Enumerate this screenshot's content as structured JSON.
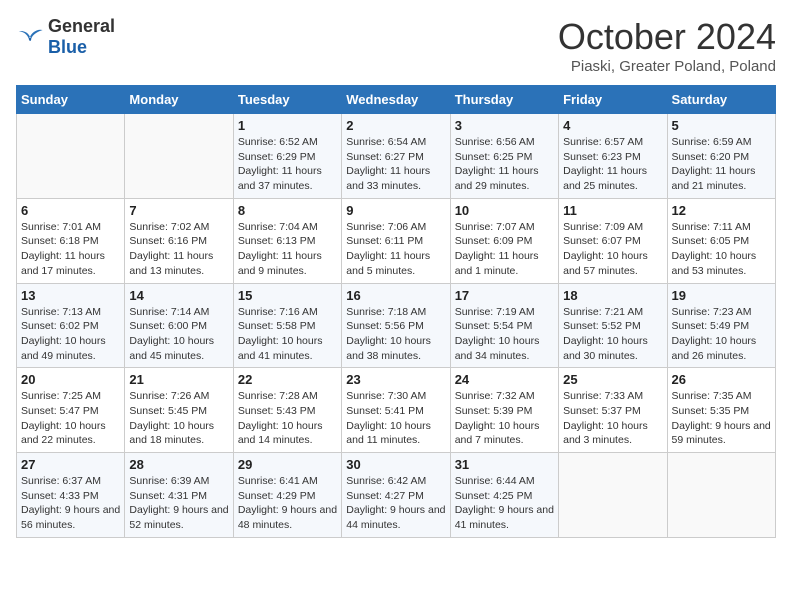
{
  "header": {
    "logo_general": "General",
    "logo_blue": "Blue",
    "month_title": "October 2024",
    "location": "Piaski, Greater Poland, Poland"
  },
  "weekdays": [
    "Sunday",
    "Monday",
    "Tuesday",
    "Wednesday",
    "Thursday",
    "Friday",
    "Saturday"
  ],
  "weeks": [
    [
      {
        "day": "",
        "detail": ""
      },
      {
        "day": "",
        "detail": ""
      },
      {
        "day": "1",
        "detail": "Sunrise: 6:52 AM\nSunset: 6:29 PM\nDaylight: 11 hours and 37 minutes."
      },
      {
        "day": "2",
        "detail": "Sunrise: 6:54 AM\nSunset: 6:27 PM\nDaylight: 11 hours and 33 minutes."
      },
      {
        "day": "3",
        "detail": "Sunrise: 6:56 AM\nSunset: 6:25 PM\nDaylight: 11 hours and 29 minutes."
      },
      {
        "day": "4",
        "detail": "Sunrise: 6:57 AM\nSunset: 6:23 PM\nDaylight: 11 hours and 25 minutes."
      },
      {
        "day": "5",
        "detail": "Sunrise: 6:59 AM\nSunset: 6:20 PM\nDaylight: 11 hours and 21 minutes."
      }
    ],
    [
      {
        "day": "6",
        "detail": "Sunrise: 7:01 AM\nSunset: 6:18 PM\nDaylight: 11 hours and 17 minutes."
      },
      {
        "day": "7",
        "detail": "Sunrise: 7:02 AM\nSunset: 6:16 PM\nDaylight: 11 hours and 13 minutes."
      },
      {
        "day": "8",
        "detail": "Sunrise: 7:04 AM\nSunset: 6:13 PM\nDaylight: 11 hours and 9 minutes."
      },
      {
        "day": "9",
        "detail": "Sunrise: 7:06 AM\nSunset: 6:11 PM\nDaylight: 11 hours and 5 minutes."
      },
      {
        "day": "10",
        "detail": "Sunrise: 7:07 AM\nSunset: 6:09 PM\nDaylight: 11 hours and 1 minute."
      },
      {
        "day": "11",
        "detail": "Sunrise: 7:09 AM\nSunset: 6:07 PM\nDaylight: 10 hours and 57 minutes."
      },
      {
        "day": "12",
        "detail": "Sunrise: 7:11 AM\nSunset: 6:05 PM\nDaylight: 10 hours and 53 minutes."
      }
    ],
    [
      {
        "day": "13",
        "detail": "Sunrise: 7:13 AM\nSunset: 6:02 PM\nDaylight: 10 hours and 49 minutes."
      },
      {
        "day": "14",
        "detail": "Sunrise: 7:14 AM\nSunset: 6:00 PM\nDaylight: 10 hours and 45 minutes."
      },
      {
        "day": "15",
        "detail": "Sunrise: 7:16 AM\nSunset: 5:58 PM\nDaylight: 10 hours and 41 minutes."
      },
      {
        "day": "16",
        "detail": "Sunrise: 7:18 AM\nSunset: 5:56 PM\nDaylight: 10 hours and 38 minutes."
      },
      {
        "day": "17",
        "detail": "Sunrise: 7:19 AM\nSunset: 5:54 PM\nDaylight: 10 hours and 34 minutes."
      },
      {
        "day": "18",
        "detail": "Sunrise: 7:21 AM\nSunset: 5:52 PM\nDaylight: 10 hours and 30 minutes."
      },
      {
        "day": "19",
        "detail": "Sunrise: 7:23 AM\nSunset: 5:49 PM\nDaylight: 10 hours and 26 minutes."
      }
    ],
    [
      {
        "day": "20",
        "detail": "Sunrise: 7:25 AM\nSunset: 5:47 PM\nDaylight: 10 hours and 22 minutes."
      },
      {
        "day": "21",
        "detail": "Sunrise: 7:26 AM\nSunset: 5:45 PM\nDaylight: 10 hours and 18 minutes."
      },
      {
        "day": "22",
        "detail": "Sunrise: 7:28 AM\nSunset: 5:43 PM\nDaylight: 10 hours and 14 minutes."
      },
      {
        "day": "23",
        "detail": "Sunrise: 7:30 AM\nSunset: 5:41 PM\nDaylight: 10 hours and 11 minutes."
      },
      {
        "day": "24",
        "detail": "Sunrise: 7:32 AM\nSunset: 5:39 PM\nDaylight: 10 hours and 7 minutes."
      },
      {
        "day": "25",
        "detail": "Sunrise: 7:33 AM\nSunset: 5:37 PM\nDaylight: 10 hours and 3 minutes."
      },
      {
        "day": "26",
        "detail": "Sunrise: 7:35 AM\nSunset: 5:35 PM\nDaylight: 9 hours and 59 minutes."
      }
    ],
    [
      {
        "day": "27",
        "detail": "Sunrise: 6:37 AM\nSunset: 4:33 PM\nDaylight: 9 hours and 56 minutes."
      },
      {
        "day": "28",
        "detail": "Sunrise: 6:39 AM\nSunset: 4:31 PM\nDaylight: 9 hours and 52 minutes."
      },
      {
        "day": "29",
        "detail": "Sunrise: 6:41 AM\nSunset: 4:29 PM\nDaylight: 9 hours and 48 minutes."
      },
      {
        "day": "30",
        "detail": "Sunrise: 6:42 AM\nSunset: 4:27 PM\nDaylight: 9 hours and 44 minutes."
      },
      {
        "day": "31",
        "detail": "Sunrise: 6:44 AM\nSunset: 4:25 PM\nDaylight: 9 hours and 41 minutes."
      },
      {
        "day": "",
        "detail": ""
      },
      {
        "day": "",
        "detail": ""
      }
    ]
  ]
}
